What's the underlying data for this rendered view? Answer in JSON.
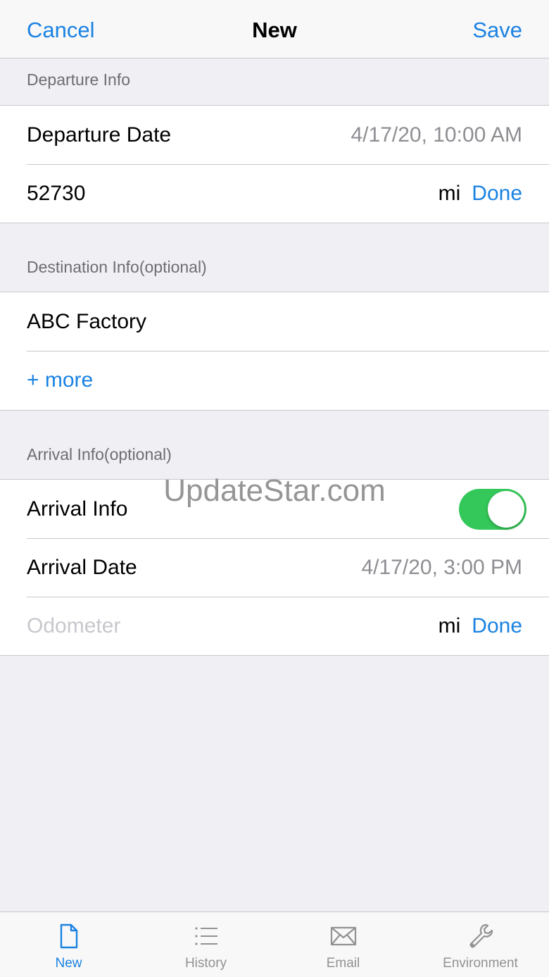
{
  "navbar": {
    "cancel": "Cancel",
    "title": "New",
    "save": "Save"
  },
  "departure": {
    "header": "Departure Info",
    "date_label": "Departure Date",
    "date_value": "4/17/20, 10:00 AM",
    "odometer_value": "52730",
    "unit": "mi",
    "done": "Done"
  },
  "destination": {
    "header": "Destination Info(optional)",
    "name_value": "ABC Factory",
    "more": "+ more"
  },
  "arrival": {
    "header": "Arrival Info(optional)",
    "toggle_label": "Arrival Info",
    "toggle_on": true,
    "date_label": "Arrival Date",
    "date_value": "4/17/20, 3:00 PM",
    "odometer_placeholder": "Odometer",
    "unit": "mi",
    "done": "Done"
  },
  "watermark": "UpdateStar.com",
  "tabs": [
    {
      "label": "New",
      "icon": "document-icon",
      "active": true
    },
    {
      "label": "History",
      "icon": "list-icon",
      "active": false
    },
    {
      "label": "Email",
      "icon": "envelope-icon",
      "active": false
    },
    {
      "label": "Environment",
      "icon": "wrench-icon",
      "active": false
    }
  ],
  "colors": {
    "accent": "#1a82e2",
    "toggle": "#34c759",
    "background": "#efeff4"
  }
}
